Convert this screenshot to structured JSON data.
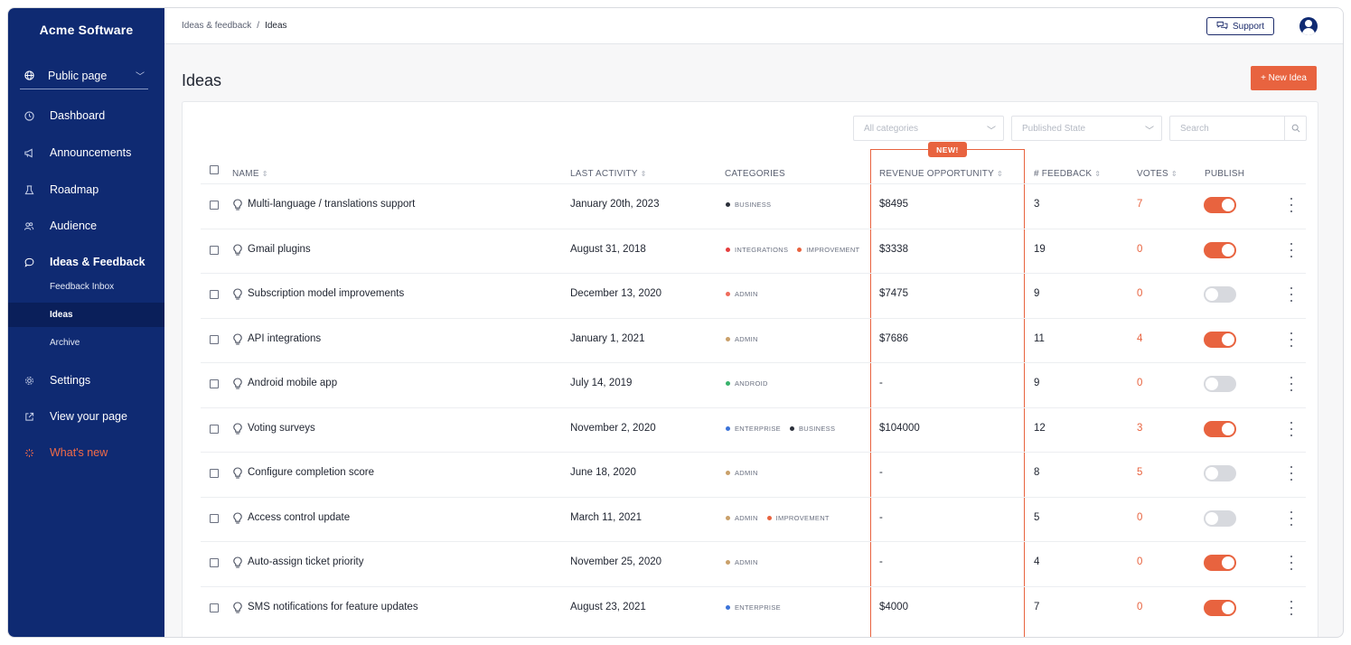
{
  "app": {
    "brand": "Acme Software"
  },
  "sidebar": {
    "public_page": {
      "label": "Public page",
      "icon": "globe-icon"
    },
    "items": [
      {
        "label": "Dashboard",
        "icon": "dashboard-icon"
      },
      {
        "label": "Announcements",
        "icon": "megaphone-icon"
      },
      {
        "label": "Roadmap",
        "icon": "roadmap-icon"
      },
      {
        "label": "Audience",
        "icon": "users-icon"
      },
      {
        "label": "Ideas & Feedback",
        "icon": "chat-icon"
      },
      {
        "label": "Settings",
        "icon": "gear-icon"
      },
      {
        "label": "View your page",
        "icon": "external-link-icon"
      },
      {
        "label": "What's new",
        "icon": "sparkle-icon"
      }
    ],
    "sub_items": [
      {
        "label": "Feedback Inbox"
      },
      {
        "label": "Ideas",
        "active": true
      },
      {
        "label": "Archive"
      }
    ]
  },
  "topbar": {
    "breadcrumb": [
      "Ideas & feedback",
      "/",
      "Ideas"
    ],
    "support_label": "Support"
  },
  "page": {
    "title": "Ideas",
    "new_button": "+ New Idea"
  },
  "filters": {
    "categories_placeholder": "All categories",
    "state_placeholder": "Published State",
    "search_placeholder": "Search"
  },
  "table": {
    "new_badge": "NEW!",
    "headers": {
      "name": "NAME",
      "last_activity": "LAST ACTIVITY",
      "categories": "CATEGORIES",
      "revenue": "REVENUE OPPORTUNITY",
      "feedback": "# FEEDBACK",
      "votes": "VOTES",
      "publish": "PUBLISH"
    },
    "rows": [
      {
        "name": "Multi-language / translations support",
        "activity": "January 20th, 2023",
        "cats": [
          {
            "label": "BUSINESS",
            "color": "#2b2f3a"
          }
        ],
        "revenue": "$8495",
        "feedback": "3",
        "votes": "7",
        "published": true
      },
      {
        "name": "Gmail plugins",
        "activity": "August 31, 2018",
        "cats": [
          {
            "label": "INTEGRATIONS",
            "color": "#e53e3e"
          },
          {
            "label": "IMPROVEMENT",
            "color": "#e8633f"
          }
        ],
        "revenue": "$3338",
        "feedback": "19",
        "votes": "0",
        "published": true
      },
      {
        "name": "Subscription model improvements",
        "activity": "December 13, 2020",
        "cats": [
          {
            "label": "ADMIN",
            "color": "#ef6b5b"
          }
        ],
        "revenue": "$7475",
        "feedback": "9",
        "votes": "0",
        "published": false
      },
      {
        "name": "API integrations",
        "activity": "January 1, 2021",
        "cats": [
          {
            "label": "ADMIN",
            "color": "#c9a06a"
          }
        ],
        "revenue": "$7686",
        "feedback": "11",
        "votes": "4",
        "published": true
      },
      {
        "name": "Android mobile app",
        "activity": "July 14, 2019",
        "cats": [
          {
            "label": "ANDROID",
            "color": "#38b26b"
          }
        ],
        "revenue": "-",
        "feedback": "9",
        "votes": "0",
        "published": false
      },
      {
        "name": "Voting surveys",
        "activity": "November 2, 2020",
        "cats": [
          {
            "label": "ENTERPRISE",
            "color": "#3b73d8"
          },
          {
            "label": "BUSINESS",
            "color": "#2b2f3a"
          }
        ],
        "revenue": "$104000",
        "feedback": "12",
        "votes": "3",
        "published": true
      },
      {
        "name": "Configure completion score",
        "activity": "June 18, 2020",
        "cats": [
          {
            "label": "ADMIN",
            "color": "#c9a06a"
          }
        ],
        "revenue": "-",
        "feedback": "8",
        "votes": "5",
        "published": false
      },
      {
        "name": "Access control update",
        "activity": "March 11, 2021",
        "cats": [
          {
            "label": "ADMIN",
            "color": "#c9a06a"
          },
          {
            "label": "IMPROVEMENT",
            "color": "#e8633f"
          }
        ],
        "revenue": "-",
        "feedback": "5",
        "votes": "0",
        "published": false
      },
      {
        "name": "Auto-assign ticket priority",
        "activity": "November 25, 2020",
        "cats": [
          {
            "label": "ADMIN",
            "color": "#c9a06a"
          }
        ],
        "revenue": "-",
        "feedback": "4",
        "votes": "0",
        "published": true
      },
      {
        "name": "SMS notifications for feature updates",
        "activity": "August 23, 2021",
        "cats": [
          {
            "label": "ENTERPRISE",
            "color": "#3b73d8"
          }
        ],
        "revenue": "$4000",
        "feedback": "7",
        "votes": "0",
        "published": true
      }
    ]
  },
  "colors": {
    "accent": "#e8633f",
    "sidebar": "#0f2a72"
  }
}
